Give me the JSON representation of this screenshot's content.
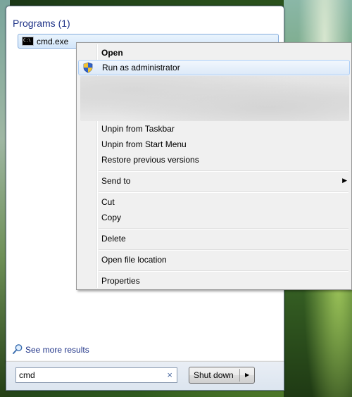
{
  "start_menu": {
    "section_title": "Programs (1)",
    "program": {
      "label": "cmd.exe",
      "icon_text": "C:\\",
      "icon": "cmd-icon"
    },
    "see_more_label": "See more results",
    "search": {
      "value": "cmd",
      "clear_glyph": "×"
    },
    "shutdown": {
      "label": "Shut down",
      "arrow": "▶"
    }
  },
  "context_menu": {
    "items": [
      {
        "label": "Open",
        "bold": true
      },
      {
        "label": "Run as administrator",
        "icon": "uac-shield-icon",
        "highlighted": true
      },
      {
        "label": "Unpin from Taskbar"
      },
      {
        "label": "Unpin from Start Menu"
      },
      {
        "label": "Restore previous versions"
      },
      {
        "label": "Send to",
        "submenu": true
      },
      {
        "label": "Cut"
      },
      {
        "label": "Copy"
      },
      {
        "label": "Delete"
      },
      {
        "label": "Open file location"
      },
      {
        "label": "Properties"
      }
    ],
    "submenu_arrow": "▶"
  }
}
